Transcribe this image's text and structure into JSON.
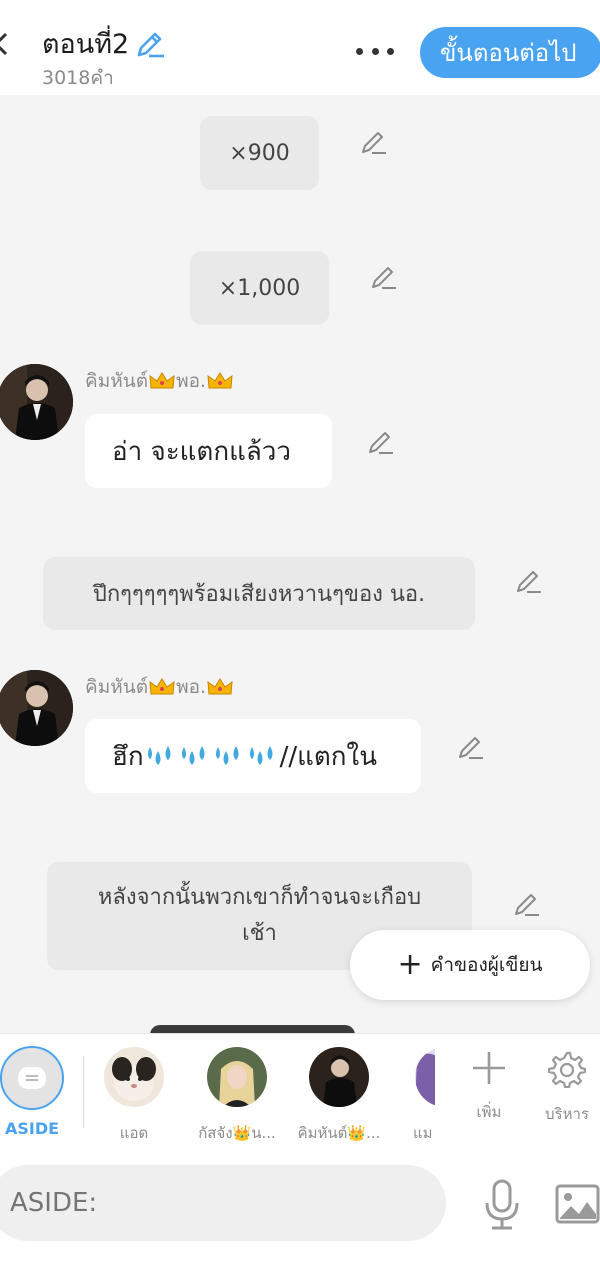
{
  "header": {
    "title": "ตอนที่2",
    "word_count": "3018คำ",
    "next_button": "ขั้นตอนต่อไป",
    "accent_color": "#4aa3f1"
  },
  "messages": [
    {
      "type": "narration",
      "text": "×900"
    },
    {
      "type": "narration",
      "text": "×1,000"
    },
    {
      "type": "character",
      "sender": "คิมหันต์👑พอ.👑",
      "sender_name": "คิมหันต์",
      "sender_suffix": "พอ.",
      "text": "อ่า จะแตกแล้วว"
    },
    {
      "type": "narration",
      "text": "ปึกๆๆๆๆๆพร้อมเสียงหวานๆของ นอ."
    },
    {
      "type": "character",
      "sender": "คิมหันต์👑พอ.👑",
      "sender_name": "คิมหันต์",
      "sender_suffix": "พอ.",
      "text_start": "ฮึก",
      "text_end": "//แตกใน"
    },
    {
      "type": "narration",
      "text_line1": "หลังจากนั้นพวกเขาก็ทำจนจะเกือบ",
      "text_line2": "เช้า"
    }
  ],
  "author_note_button": "คำของผู้เขียน",
  "characters": {
    "aside_label": "ASIDE",
    "items": [
      {
        "label": "แอด"
      },
      {
        "label": "กัสจัง👑น..."
      },
      {
        "label": "คิมหันต์👑..."
      },
      {
        "label": "แม"
      }
    ],
    "add_label": "เพิ่ม",
    "manage_label": "บริหาร"
  },
  "input": {
    "placeholder": "ASIDE:"
  },
  "icons": [
    "back-icon",
    "pencil-icon",
    "more-icon",
    "plus-icon",
    "gear-icon",
    "mic-icon",
    "image-icon",
    "crown-icon",
    "water-drop-icon"
  ]
}
